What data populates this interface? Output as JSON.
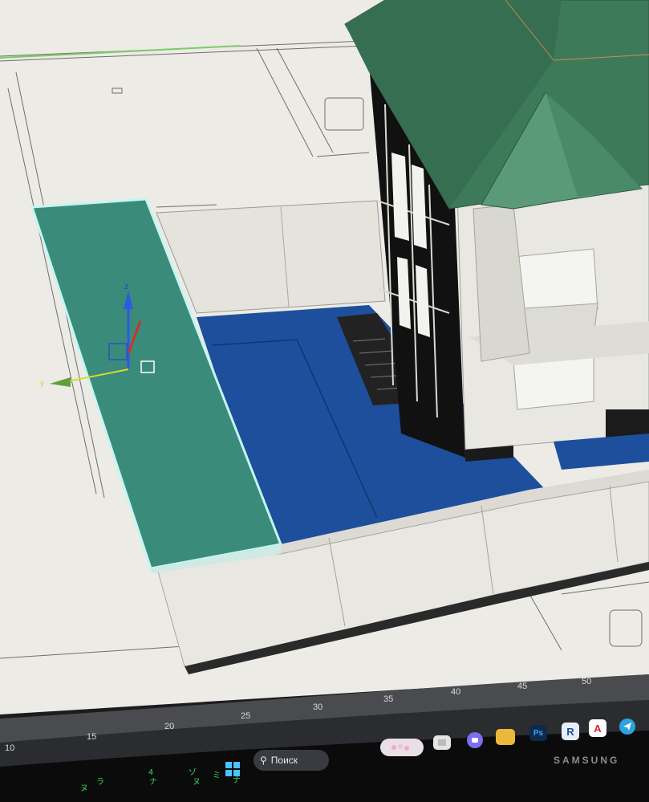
{
  "viewport": {
    "gizmo_axes": {
      "x": "x",
      "y": "y",
      "z": "z"
    }
  },
  "timeline": {
    "ticks": [
      "10",
      "15",
      "20",
      "25",
      "30",
      "35",
      "40",
      "45",
      "50"
    ]
  },
  "taskbar": {
    "search_label": "Поиск",
    "apps": [
      {
        "name": "file-explorer",
        "label": ""
      },
      {
        "name": "photoshop",
        "label": "Ps"
      },
      {
        "name": "revit",
        "label": "R"
      },
      {
        "name": "autocad",
        "label": "A"
      }
    ]
  },
  "monitor": {
    "brand": "SAMSUNG"
  },
  "colors": {
    "roof": "#3f7a5c",
    "selected_slab": "#3a8c7c",
    "selection_outline": "#bff3f0",
    "floor": "#1c4c9a",
    "wall": "#e8e6e0",
    "paper": "#eeede8"
  }
}
